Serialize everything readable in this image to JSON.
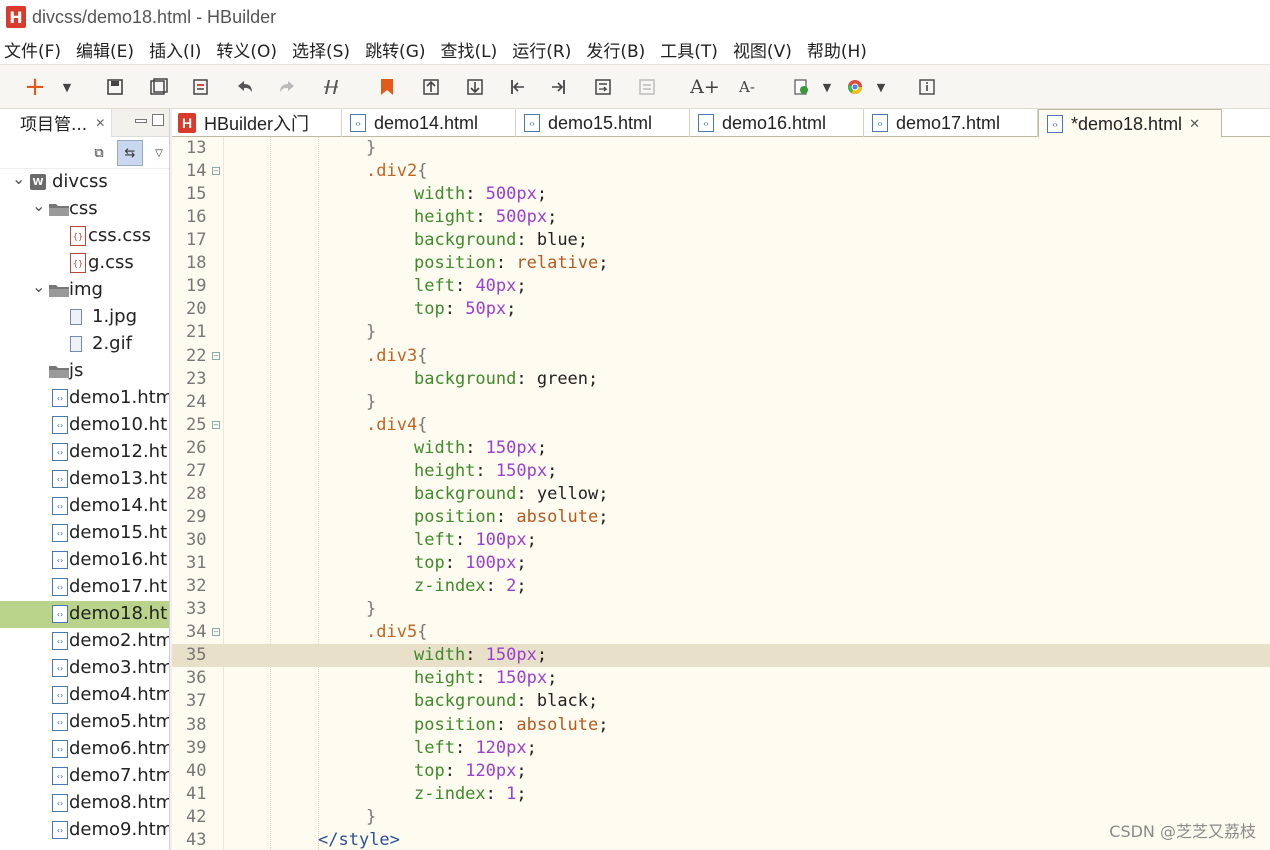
{
  "window": {
    "title": "divcss/demo18.html  -  HBuilder",
    "logo_text": "H"
  },
  "menubar": [
    "文件(F)",
    "编辑(E)",
    "插入(I)",
    "转义(O)",
    "选择(S)",
    "跳转(G)",
    "查找(L)",
    "运行(R)",
    "发行(B)",
    "工具(T)",
    "视图(V)",
    "帮助(H)"
  ],
  "toolbar": {
    "icons": [
      "new-plus-icon",
      "dropdown-icon",
      "save-icon",
      "save-all-icon",
      "history-icon",
      "undo-icon",
      "redo-icon",
      "format-icon",
      "bookmark-icon",
      "goto-top-icon",
      "goto-bottom-icon",
      "goto-start-icon",
      "goto-end-icon",
      "wrap-icon",
      "comment-icon",
      "font-increase-icon",
      "font-decrease-icon",
      "run-icon",
      "dropdown-icon",
      "chrome-icon",
      "dropdown-icon",
      "info-icon"
    ],
    "font_increase_label": "A+",
    "font_decrease_label": "A-"
  },
  "project_panel": {
    "tab_label": "项目管...",
    "tree": [
      {
        "label": "divcss",
        "type": "project",
        "level": 0,
        "expanded": true
      },
      {
        "label": "css",
        "type": "folder",
        "level": 1,
        "expanded": true
      },
      {
        "label": "css.css",
        "type": "css",
        "level": 2
      },
      {
        "label": "g.css",
        "type": "css",
        "level": 2
      },
      {
        "label": "img",
        "type": "folder",
        "level": 1,
        "expanded": true
      },
      {
        "label": "1.jpg",
        "type": "image",
        "level": 2
      },
      {
        "label": "2.gif",
        "type": "image",
        "level": 2
      },
      {
        "label": "js",
        "type": "folder",
        "level": 1,
        "expanded": false
      },
      {
        "label": "demo1.htm",
        "type": "html",
        "level": 1
      },
      {
        "label": "demo10.ht",
        "type": "html",
        "level": 1
      },
      {
        "label": "demo12.ht",
        "type": "html",
        "level": 1
      },
      {
        "label": "demo13.ht",
        "type": "html",
        "level": 1
      },
      {
        "label": "demo14.ht",
        "type": "html",
        "level": 1
      },
      {
        "label": "demo15.ht",
        "type": "html",
        "level": 1
      },
      {
        "label": "demo16.ht",
        "type": "html",
        "level": 1
      },
      {
        "label": "demo17.ht",
        "type": "html",
        "level": 1
      },
      {
        "label": "demo18.ht",
        "type": "html",
        "level": 1,
        "selected": true
      },
      {
        "label": "demo2.htm",
        "type": "html",
        "level": 1
      },
      {
        "label": "demo3.htm",
        "type": "html",
        "level": 1
      },
      {
        "label": "demo4.htm",
        "type": "html",
        "level": 1
      },
      {
        "label": "demo5.htm",
        "type": "html",
        "level": 1
      },
      {
        "label": "demo6.htm",
        "type": "html",
        "level": 1
      },
      {
        "label": "demo7.htm",
        "type": "html",
        "level": 1
      },
      {
        "label": "demo8.htm",
        "type": "html",
        "level": 1
      },
      {
        "label": "demo9.htm",
        "type": "html",
        "level": 1
      }
    ]
  },
  "editor_tabs": [
    {
      "label": "HBuilder入门",
      "icon": "hbuilder-icon"
    },
    {
      "label": "demo14.html",
      "icon": "html-file-icon"
    },
    {
      "label": "demo15.html",
      "icon": "html-file-icon"
    },
    {
      "label": "demo16.html",
      "icon": "html-file-icon"
    },
    {
      "label": "demo17.html",
      "icon": "html-file-icon"
    },
    {
      "label": "*demo18.html",
      "icon": "html-file-icon",
      "active": true,
      "closable": true
    }
  ],
  "editor": {
    "current_line": 35,
    "lines": [
      {
        "n": "13",
        "indent": 3,
        "tokens": [
          [
            "brace",
            "}"
          ]
        ]
      },
      {
        "n": "14",
        "fold": true,
        "indent": 3,
        "tokens": [
          [
            "sel",
            ".div2"
          ],
          [
            "brace",
            "{"
          ]
        ]
      },
      {
        "n": "15",
        "indent": 4,
        "tokens": [
          [
            "prop",
            "width"
          ],
          [
            "punct",
            ": "
          ],
          [
            "num",
            "500"
          ],
          [
            "unit",
            "px"
          ],
          [
            "punct",
            ";"
          ]
        ]
      },
      {
        "n": "16",
        "indent": 4,
        "tokens": [
          [
            "prop",
            "height"
          ],
          [
            "punct",
            ": "
          ],
          [
            "num",
            "500"
          ],
          [
            "unit",
            "px"
          ],
          [
            "punct",
            ";"
          ]
        ]
      },
      {
        "n": "17",
        "indent": 4,
        "tokens": [
          [
            "prop",
            "background"
          ],
          [
            "punct",
            ": "
          ],
          [
            "plain",
            "blue"
          ],
          [
            "punct",
            ";"
          ]
        ]
      },
      {
        "n": "18",
        "indent": 4,
        "tokens": [
          [
            "prop",
            "position"
          ],
          [
            "punct",
            ": "
          ],
          [
            "kw",
            "relative"
          ],
          [
            "punct",
            ";"
          ]
        ]
      },
      {
        "n": "19",
        "indent": 4,
        "tokens": [
          [
            "prop",
            "left"
          ],
          [
            "punct",
            ": "
          ],
          [
            "num",
            "40"
          ],
          [
            "unit",
            "px"
          ],
          [
            "punct",
            ";"
          ]
        ]
      },
      {
        "n": "20",
        "indent": 4,
        "tokens": [
          [
            "prop",
            "top"
          ],
          [
            "punct",
            ": "
          ],
          [
            "num",
            "50"
          ],
          [
            "unit",
            "px"
          ],
          [
            "punct",
            ";"
          ]
        ]
      },
      {
        "n": "21",
        "indent": 3,
        "tokens": [
          [
            "brace",
            "}"
          ]
        ]
      },
      {
        "n": "22",
        "fold": true,
        "indent": 3,
        "tokens": [
          [
            "sel",
            ".div3"
          ],
          [
            "brace",
            "{"
          ]
        ]
      },
      {
        "n": "23",
        "indent": 4,
        "tokens": [
          [
            "prop",
            "background"
          ],
          [
            "punct",
            ": "
          ],
          [
            "plain",
            "green"
          ],
          [
            "punct",
            ";"
          ]
        ]
      },
      {
        "n": "24",
        "indent": 3,
        "tokens": [
          [
            "brace",
            "}"
          ]
        ]
      },
      {
        "n": "25",
        "fold": true,
        "indent": 3,
        "tokens": [
          [
            "sel",
            ".div4"
          ],
          [
            "brace",
            "{"
          ]
        ]
      },
      {
        "n": "26",
        "indent": 4,
        "tokens": [
          [
            "prop",
            "width"
          ],
          [
            "punct",
            ": "
          ],
          [
            "num",
            "150"
          ],
          [
            "unit",
            "px"
          ],
          [
            "punct",
            ";"
          ]
        ]
      },
      {
        "n": "27",
        "indent": 4,
        "tokens": [
          [
            "prop",
            "height"
          ],
          [
            "punct",
            ": "
          ],
          [
            "num",
            "150"
          ],
          [
            "unit",
            "px"
          ],
          [
            "punct",
            ";"
          ]
        ]
      },
      {
        "n": "28",
        "indent": 4,
        "tokens": [
          [
            "prop",
            "background"
          ],
          [
            "punct",
            ": "
          ],
          [
            "plain",
            "yellow"
          ],
          [
            "punct",
            ";"
          ]
        ]
      },
      {
        "n": "29",
        "indent": 4,
        "tokens": [
          [
            "prop",
            "position"
          ],
          [
            "punct",
            ": "
          ],
          [
            "kw",
            "absolute"
          ],
          [
            "punct",
            ";"
          ]
        ]
      },
      {
        "n": "30",
        "indent": 4,
        "tokens": [
          [
            "prop",
            "left"
          ],
          [
            "punct",
            ": "
          ],
          [
            "num",
            "100"
          ],
          [
            "unit",
            "px"
          ],
          [
            "punct",
            ";"
          ]
        ]
      },
      {
        "n": "31",
        "indent": 4,
        "tokens": [
          [
            "prop",
            "top"
          ],
          [
            "punct",
            ": "
          ],
          [
            "num",
            "100"
          ],
          [
            "unit",
            "px"
          ],
          [
            "punct",
            ";"
          ]
        ]
      },
      {
        "n": "32",
        "indent": 4,
        "tokens": [
          [
            "prop",
            "z-index"
          ],
          [
            "punct",
            ": "
          ],
          [
            "num",
            "2"
          ],
          [
            "punct",
            ";"
          ]
        ]
      },
      {
        "n": "33",
        "indent": 3,
        "tokens": [
          [
            "brace",
            "}"
          ]
        ]
      },
      {
        "n": "34",
        "fold": true,
        "indent": 3,
        "tokens": [
          [
            "sel",
            ".div5"
          ],
          [
            "brace",
            "{"
          ]
        ]
      },
      {
        "n": "35",
        "indent": 4,
        "tokens": [
          [
            "prop",
            "width"
          ],
          [
            "punct",
            ": "
          ],
          [
            "num",
            "150"
          ],
          [
            "unit",
            "px"
          ],
          [
            "punct",
            ";"
          ]
        ]
      },
      {
        "n": "36",
        "indent": 4,
        "tokens": [
          [
            "prop",
            "height"
          ],
          [
            "punct",
            ": "
          ],
          [
            "num",
            "150"
          ],
          [
            "unit",
            "px"
          ],
          [
            "punct",
            ";"
          ]
        ]
      },
      {
        "n": "37",
        "indent": 4,
        "tokens": [
          [
            "prop",
            "background"
          ],
          [
            "punct",
            ": "
          ],
          [
            "plain",
            "black"
          ],
          [
            "punct",
            ";"
          ]
        ]
      },
      {
        "n": "38",
        "indent": 4,
        "tokens": [
          [
            "prop",
            "position"
          ],
          [
            "punct",
            ": "
          ],
          [
            "kw",
            "absolute"
          ],
          [
            "punct",
            ";"
          ]
        ]
      },
      {
        "n": "39",
        "indent": 4,
        "tokens": [
          [
            "prop",
            "left"
          ],
          [
            "punct",
            ": "
          ],
          [
            "num",
            "120"
          ],
          [
            "unit",
            "px"
          ],
          [
            "punct",
            ";"
          ]
        ]
      },
      {
        "n": "40",
        "indent": 4,
        "tokens": [
          [
            "prop",
            "top"
          ],
          [
            "punct",
            ": "
          ],
          [
            "num",
            "120"
          ],
          [
            "unit",
            "px"
          ],
          [
            "punct",
            ";"
          ]
        ]
      },
      {
        "n": "41",
        "indent": 4,
        "tokens": [
          [
            "prop",
            "z-index"
          ],
          [
            "punct",
            ": "
          ],
          [
            "num",
            "1"
          ],
          [
            "punct",
            ";"
          ]
        ]
      },
      {
        "n": "42",
        "indent": 3,
        "tokens": [
          [
            "brace",
            "}"
          ]
        ]
      },
      {
        "n": "43",
        "indent": 2,
        "tokens": [
          [
            "tag",
            "</"
          ],
          [
            "tag",
            "style"
          ],
          [
            "tag",
            ">"
          ]
        ]
      }
    ]
  },
  "watermark": "CSDN @芝芝又荔枝",
  "colors": {
    "editor_bg": "#fefbf0",
    "current_line": "#e8e0c8",
    "selected_tree_row": "#b9d48a",
    "selector": "#c2651f",
    "property": "#3f8a2a",
    "number": "#9a3fd2",
    "keyword": "#b35a1e",
    "tag": "#2a4f9a"
  }
}
